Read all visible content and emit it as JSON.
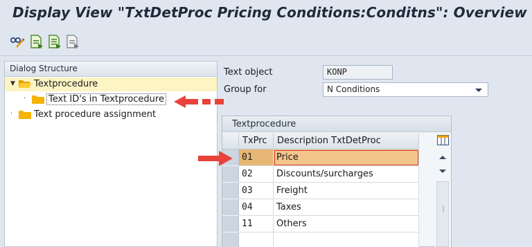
{
  "window": {
    "title": "Display View \"TxtDetProc Pricing Conditions:Conditns\": Overview"
  },
  "toolbar": {
    "buttons": [
      {
        "icon": "glasses-pen-icon",
        "name": "display-change"
      },
      {
        "icon": "doc-green-icon",
        "name": "details"
      },
      {
        "icon": "doc-green-list-icon",
        "name": "select-all"
      },
      {
        "icon": "doc-gray-icon",
        "name": "select-block"
      }
    ]
  },
  "dialog_structure": {
    "header": "Dialog Structure",
    "items": [
      {
        "label": "Textprocedure",
        "selected": true,
        "expanded": true,
        "level": 0
      },
      {
        "label": "Text ID's in Textprocedure",
        "selected": false,
        "level": 1
      },
      {
        "label": "Text procedure assignment",
        "selected": false,
        "level": 0
      }
    ]
  },
  "fields": {
    "text_object": {
      "label": "Text object",
      "value": "KONP"
    },
    "group_for": {
      "label": "Group for",
      "value": "N Conditions"
    }
  },
  "textprocedure_table": {
    "title": "Textprocedure",
    "columns": [
      "TxPrc",
      "Description TxtDetProc"
    ],
    "rows": [
      {
        "code": "01",
        "description": "Price",
        "selected": true
      },
      {
        "code": "02",
        "description": "Discounts/surcharges"
      },
      {
        "code": "03",
        "description": "Freight"
      },
      {
        "code": "04",
        "description": "Taxes"
      },
      {
        "code": "11",
        "description": "Others"
      },
      {
        "code": "",
        "description": ""
      }
    ]
  },
  "colors": {
    "background": "#dfe6ef",
    "selected_tree_row": "#fdf4c4",
    "selected_table_row": "#e6b774",
    "annotation_arrow": "#e8423a",
    "folder": "#f6b300"
  }
}
